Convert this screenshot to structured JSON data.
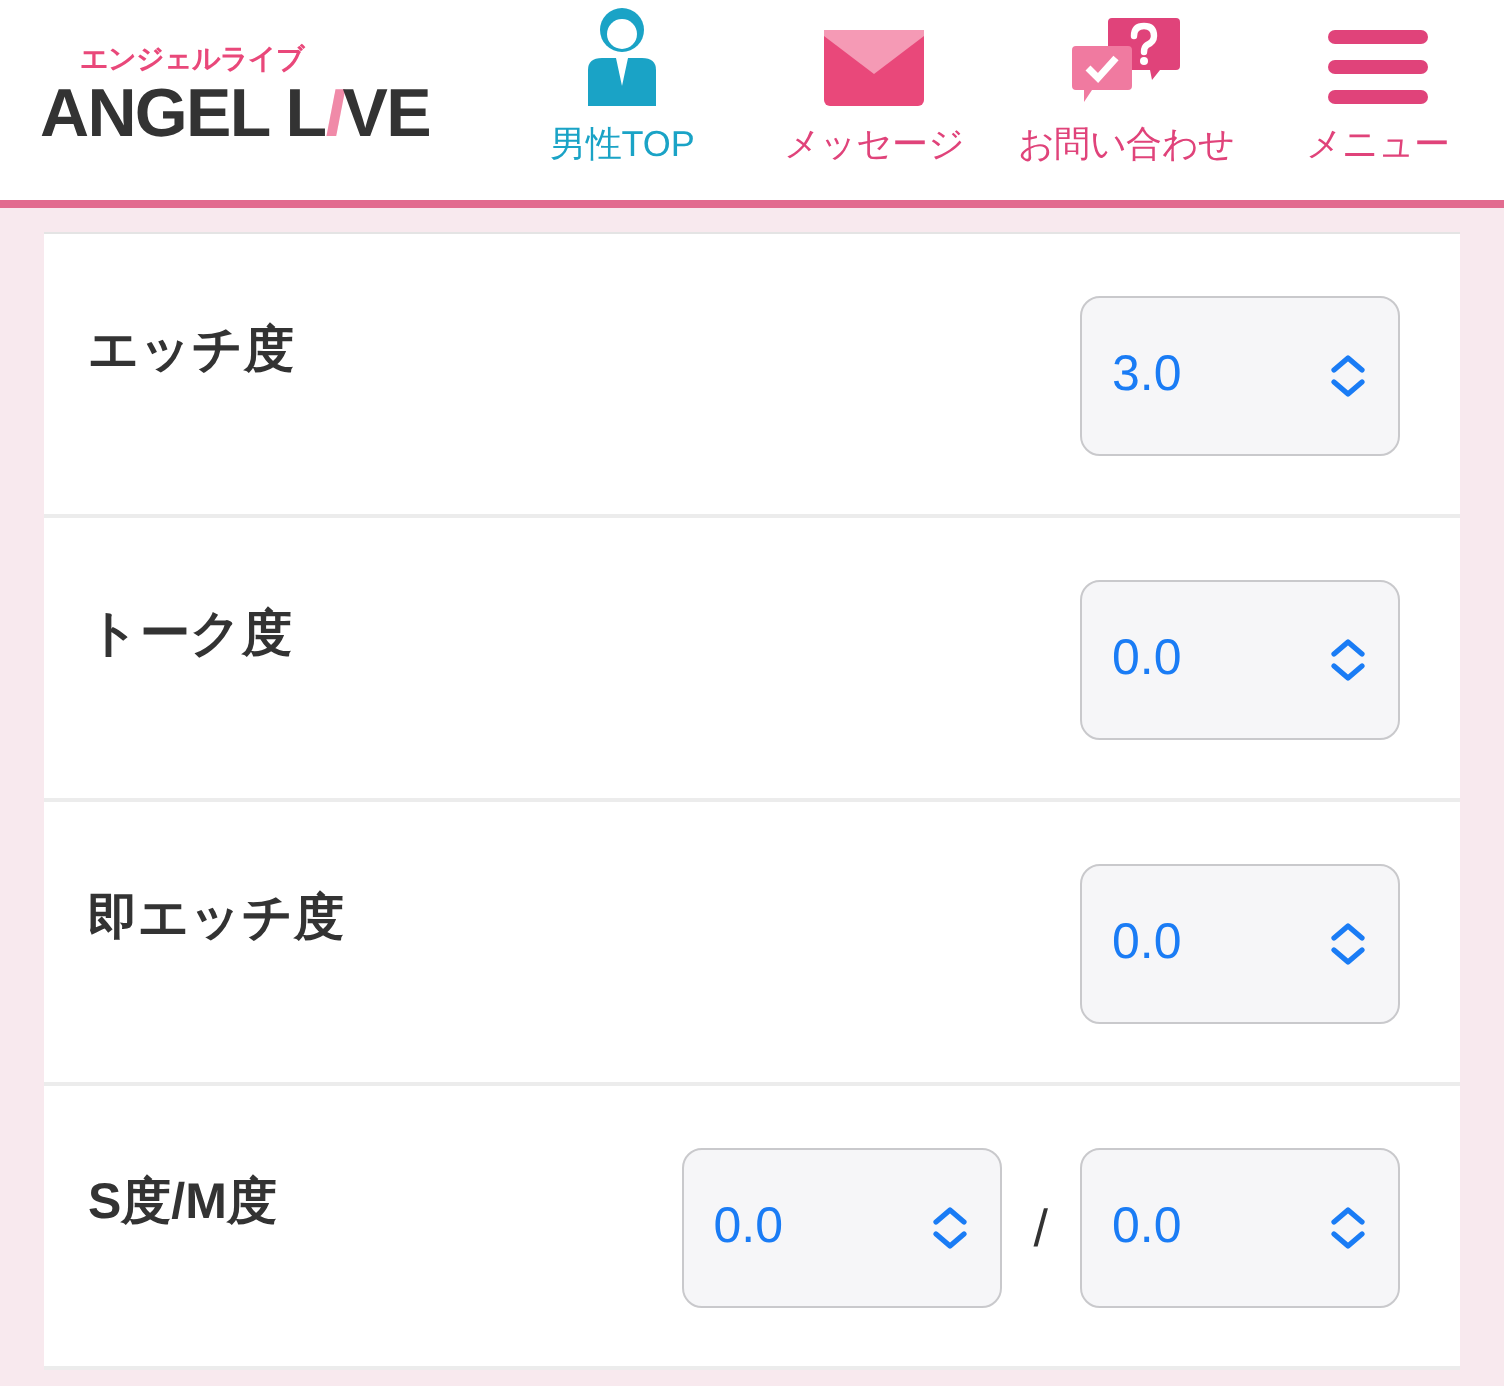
{
  "header": {
    "logo": {
      "subtitle": "エンジェルライブ",
      "wordmark": [
        "ANGEL L",
        "I",
        "VE"
      ]
    },
    "nav": [
      {
        "kind": "person",
        "label": "男性TOP",
        "selected": true
      },
      {
        "kind": "mail",
        "label": "メッセージ",
        "selected": false
      },
      {
        "kind": "chat",
        "label": "お問い合わせ",
        "selected": false
      },
      {
        "kind": "menu",
        "label": "メニュー",
        "selected": false
      }
    ]
  },
  "rows": [
    {
      "label": "エッチ度",
      "values": [
        "3.0"
      ]
    },
    {
      "label": "トーク度",
      "values": [
        "0.0"
      ]
    },
    {
      "label": "即エッチ度",
      "values": [
        "0.0"
      ]
    },
    {
      "label": "S度/M度",
      "values": [
        "0.0",
        "0.0"
      ],
      "separator": "/"
    }
  ]
}
